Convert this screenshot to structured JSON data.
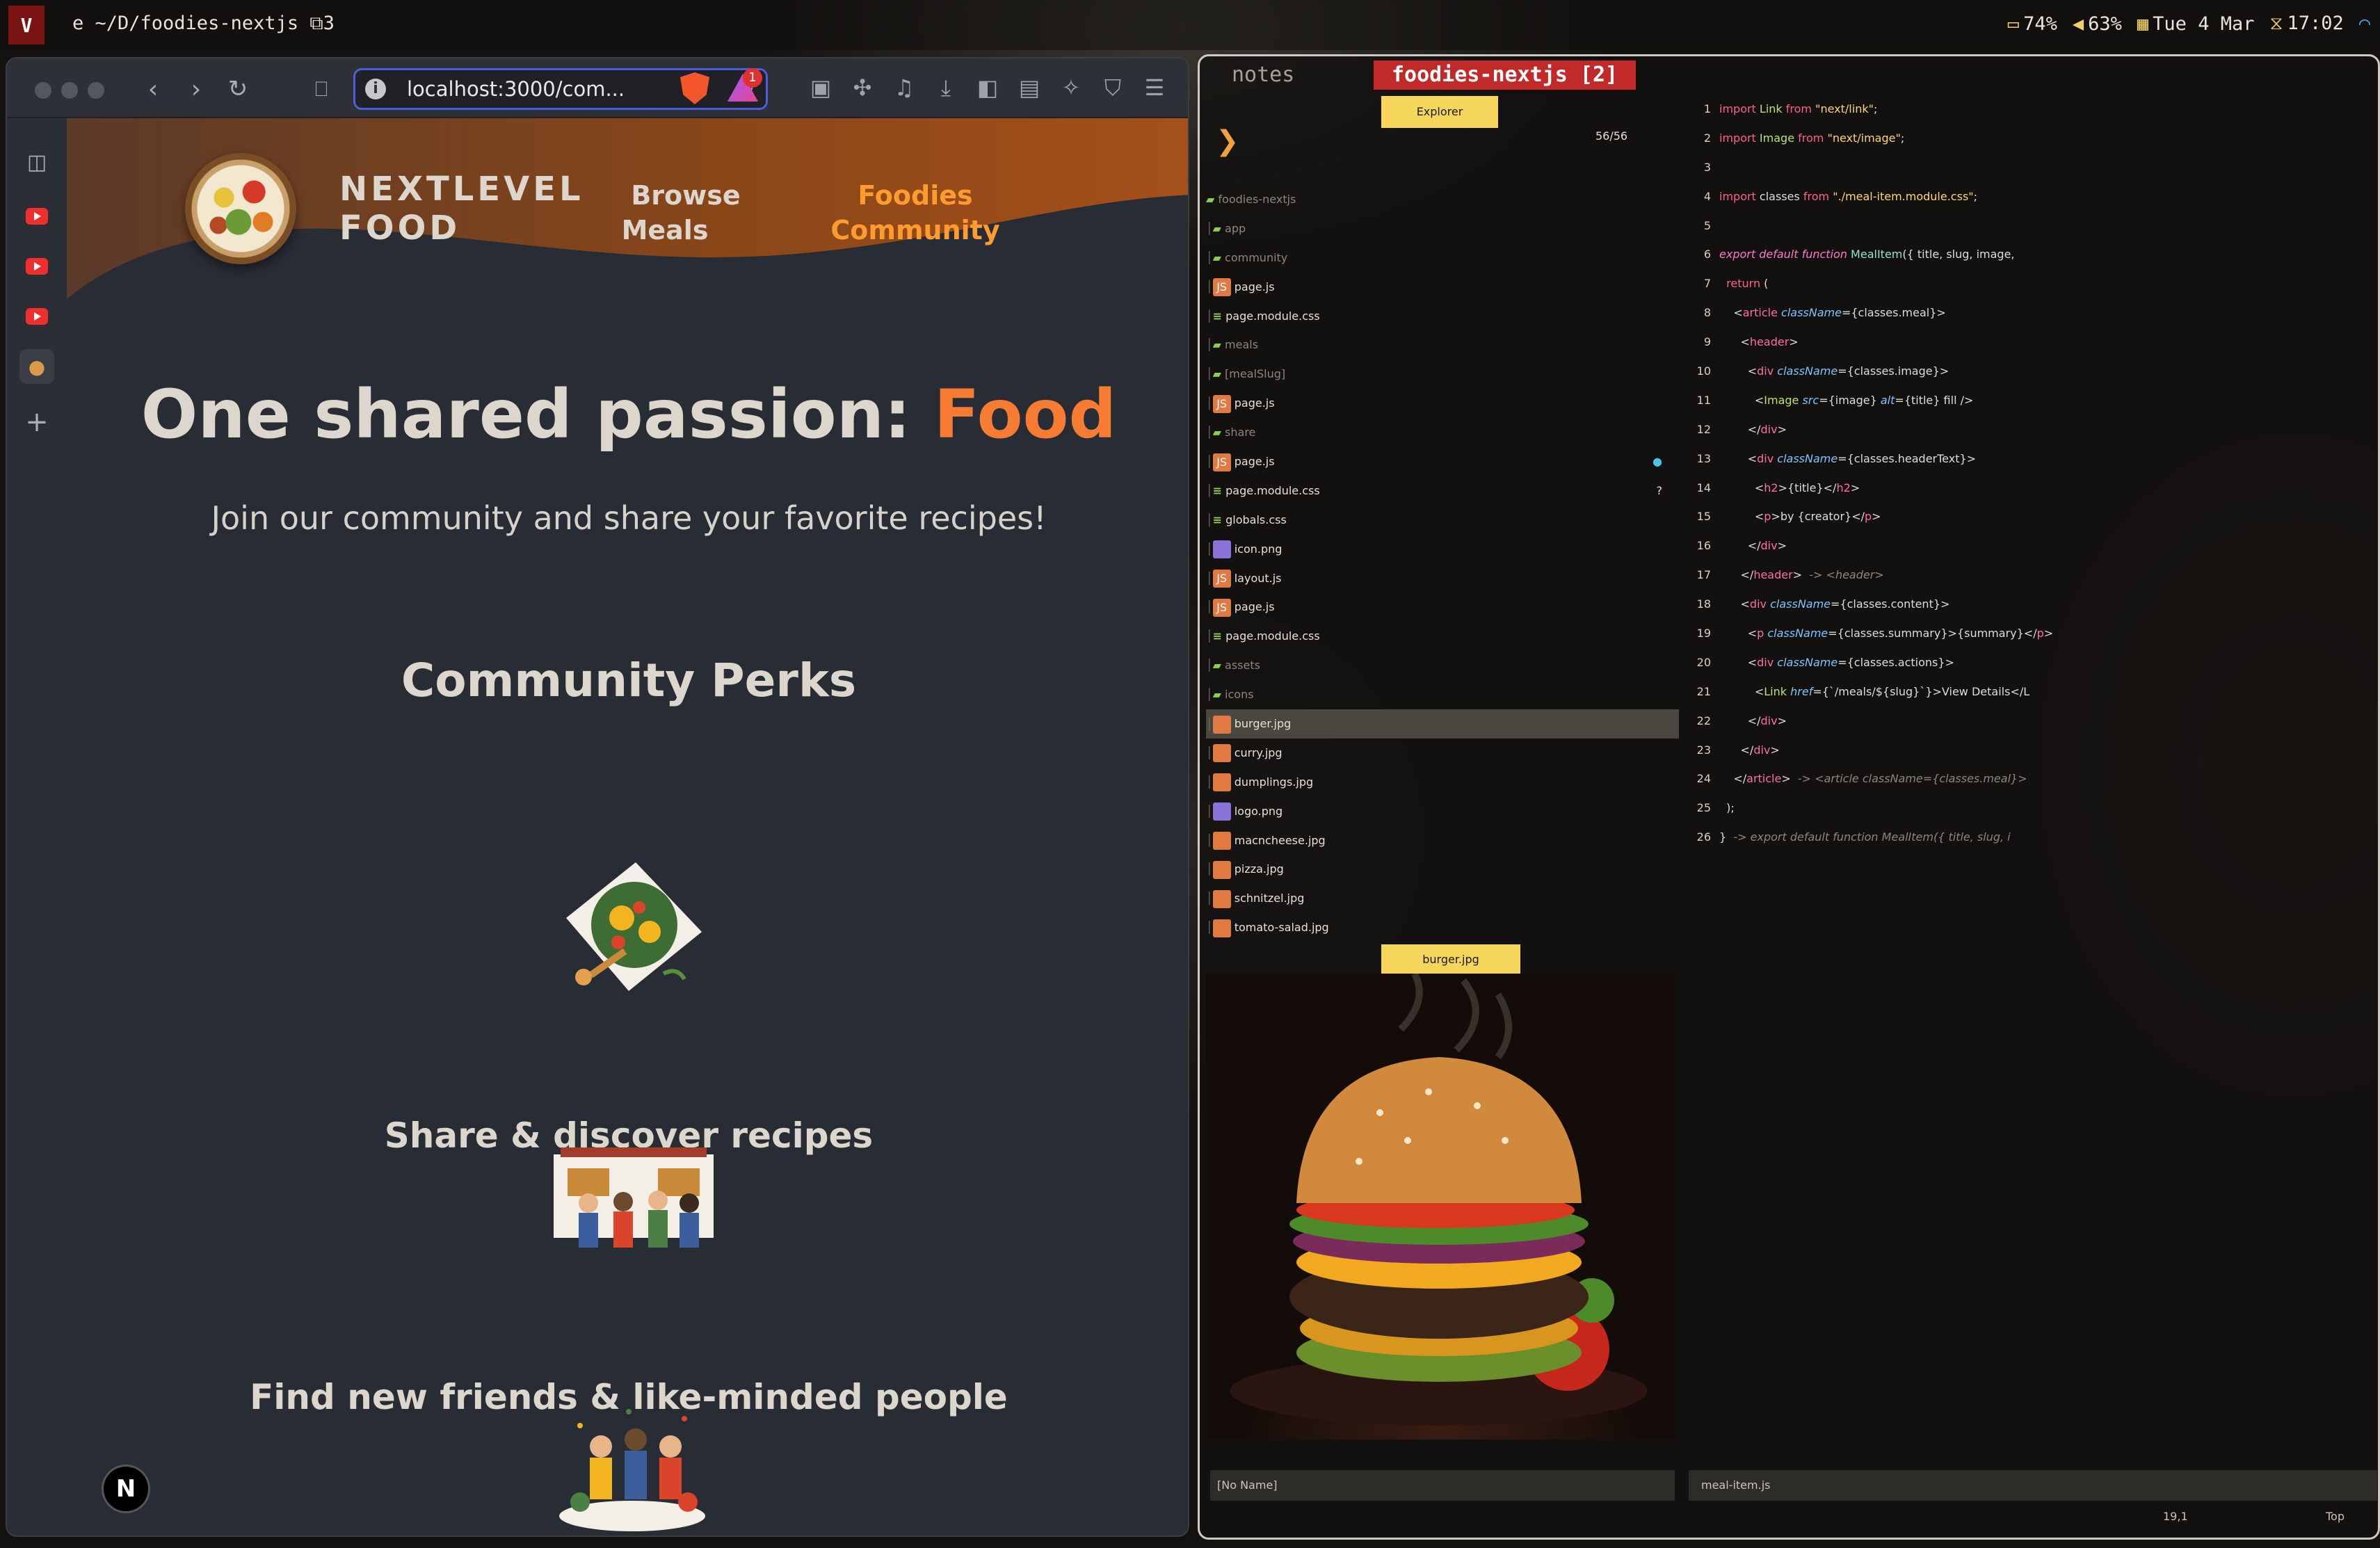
{
  "topbar": {
    "workspace": "V",
    "window_title": "e ~/D/foodies-nextjs",
    "window_count": "3",
    "battery": "74%",
    "volume": "63%",
    "day": "Tue",
    "date": "4 Mar",
    "time": "17:02"
  },
  "browser": {
    "url": "localhost:3000/com...",
    "notification_badge": "1"
  },
  "site": {
    "logo_line1": "NEXTLEVEL",
    "logo_line2": "FOOD",
    "nav_browse_line1": "Browse",
    "nav_browse_line2": "Meals",
    "nav_community_line1": "Foodies",
    "nav_community_line2": "Community",
    "hero_title_prefix": "One shared passion: ",
    "hero_title_accent": "Food",
    "hero_subtitle": "Join our community and share your favorite recipes!",
    "perks_title": "Community Perks",
    "perks": [
      "Share & discover recipes",
      "Find new friends & like-minded people"
    ],
    "next_badge": "N"
  },
  "nvim": {
    "tabs": [
      "notes",
      "foodies-nextjs [2]"
    ],
    "explorer_title": "Explorer",
    "explorer_count": "56/56",
    "tree": [
      {
        "name": "foodies-nextjs",
        "kind": "folder",
        "depth": 0
      },
      {
        "name": "app",
        "kind": "folder",
        "depth": 1
      },
      {
        "name": "community",
        "kind": "folder",
        "depth": 2
      },
      {
        "name": "page.js",
        "kind": "js",
        "depth": 3
      },
      {
        "name": "page.module.css",
        "kind": "css",
        "depth": 3
      },
      {
        "name": "meals",
        "kind": "folder",
        "depth": 2
      },
      {
        "name": "[mealSlug]",
        "kind": "folder",
        "depth": 3
      },
      {
        "name": "page.js",
        "kind": "js",
        "depth": 4
      },
      {
        "name": "share",
        "kind": "folder",
        "depth": 3
      },
      {
        "name": "page.js",
        "kind": "js",
        "depth": 3,
        "mark": "●"
      },
      {
        "name": "page.module.css",
        "kind": "css",
        "depth": 3,
        "mark": "?"
      },
      {
        "name": "globals.css",
        "kind": "css",
        "depth": 2
      },
      {
        "name": "icon.png",
        "kind": "png",
        "depth": 2
      },
      {
        "name": "layout.js",
        "kind": "js",
        "depth": 2
      },
      {
        "name": "page.js",
        "kind": "js",
        "depth": 2
      },
      {
        "name": "page.module.css",
        "kind": "css",
        "depth": 2
      },
      {
        "name": "assets",
        "kind": "folder",
        "depth": 1
      },
      {
        "name": "icons",
        "kind": "folder",
        "depth": 2
      },
      {
        "name": "burger.jpg",
        "kind": "jpg",
        "depth": 2,
        "selected": true
      },
      {
        "name": "curry.jpg",
        "kind": "jpg",
        "depth": 2
      },
      {
        "name": "dumplings.jpg",
        "kind": "jpg",
        "depth": 2
      },
      {
        "name": "logo.png",
        "kind": "png",
        "depth": 2
      },
      {
        "name": "macncheese.jpg",
        "kind": "jpg",
        "depth": 2
      },
      {
        "name": "pizza.jpg",
        "kind": "jpg",
        "depth": 2
      },
      {
        "name": "schnitzel.jpg",
        "kind": "jpg",
        "depth": 2
      },
      {
        "name": "tomato-salad.jpg",
        "kind": "jpg",
        "depth": 2
      }
    ],
    "preview_label": "burger.jpg",
    "code_lines": [
      "import Link from \"next/link\";",
      "import Image from \"next/image\";",
      "",
      "import classes from \"./meal-item.module.css\";",
      "",
      "export default function MealItem({ title, slug, image,",
      "  return (",
      "    <article className={classes.meal}>",
      "      <header>",
      "        <div className={classes.image}>",
      "          <Image src={image} alt={title} fill />",
      "        </div>",
      "        <div className={classes.headerText}>",
      "          <h2>{title}</h2>",
      "          <p>by {creator}</p>",
      "        </div>",
      "      </header>  -> <header>",
      "      <div className={classes.content}>",
      "        <p className={classes.summary}>{summary}</p>",
      "        <div className={classes.actions}>",
      "          <Link href={`/meals/${slug}`}>View Details</L",
      "        </div>",
      "      </div>",
      "    </article>  -> <article className={classes.meal}>",
      "  );",
      "}  -> export default function MealItem({ title, slug, i"
    ],
    "status_left": "[No Name]",
    "status_right": "meal-item.js",
    "cursor_pos": "19,1",
    "scroll_pos": "Top"
  }
}
